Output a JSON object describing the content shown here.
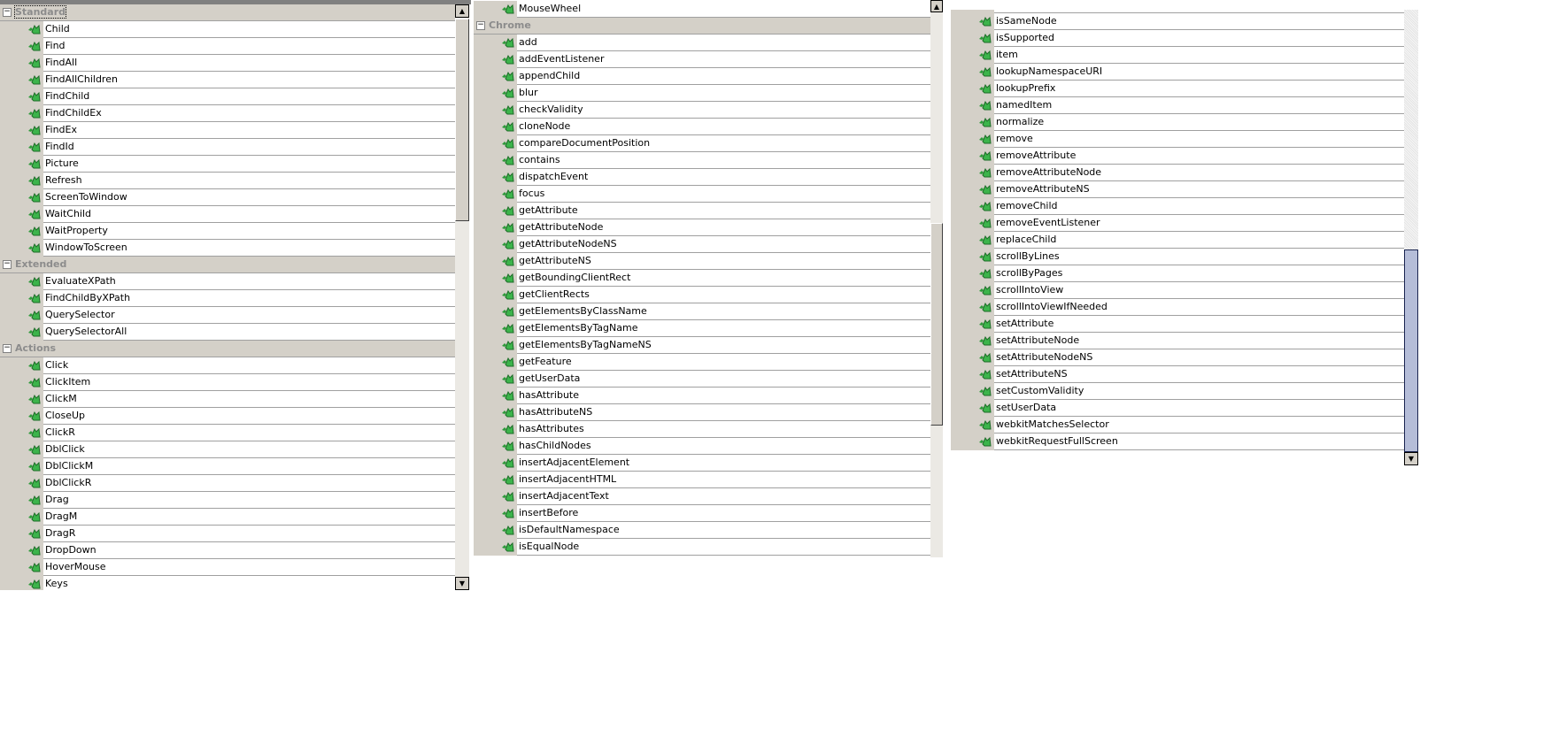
{
  "icons": {
    "method": "method-icon",
    "collapse": "collapse-toggle-icon"
  },
  "colors": {
    "header_bg": "#d4d0c8",
    "group_text": "#8c8c8c",
    "icon_green": "#2e9a3a",
    "thumb_blue": "#b5bdd8"
  },
  "panel1": {
    "rows": [
      {
        "type": "group",
        "label": "Standard"
      },
      {
        "type": "item",
        "label": "Child"
      },
      {
        "type": "item",
        "label": "Find"
      },
      {
        "type": "item",
        "label": "FindAll"
      },
      {
        "type": "item",
        "label": "FindAllChildren"
      },
      {
        "type": "item",
        "label": "FindChild"
      },
      {
        "type": "item",
        "label": "FindChildEx"
      },
      {
        "type": "item",
        "label": "FindEx"
      },
      {
        "type": "item",
        "label": "FindId"
      },
      {
        "type": "item",
        "label": "Picture"
      },
      {
        "type": "item",
        "label": "Refresh"
      },
      {
        "type": "item",
        "label": "ScreenToWindow"
      },
      {
        "type": "item",
        "label": "WaitChild"
      },
      {
        "type": "item",
        "label": "WaitProperty"
      },
      {
        "type": "item",
        "label": "WindowToScreen"
      },
      {
        "type": "group",
        "label": "Extended"
      },
      {
        "type": "item",
        "label": "EvaluateXPath"
      },
      {
        "type": "item",
        "label": "FindChildByXPath"
      },
      {
        "type": "item",
        "label": "QuerySelector"
      },
      {
        "type": "item",
        "label": "QuerySelectorAll"
      },
      {
        "type": "group",
        "label": "Actions"
      },
      {
        "type": "item",
        "label": "Click"
      },
      {
        "type": "item",
        "label": "ClickItem"
      },
      {
        "type": "item",
        "label": "ClickM"
      },
      {
        "type": "item",
        "label": "CloseUp"
      },
      {
        "type": "item",
        "label": "ClickR"
      },
      {
        "type": "item",
        "label": "DblClick"
      },
      {
        "type": "item",
        "label": "DblClickM"
      },
      {
        "type": "item",
        "label": "DblClickR"
      },
      {
        "type": "item",
        "label": "Drag"
      },
      {
        "type": "item",
        "label": "DragM"
      },
      {
        "type": "item",
        "label": "DragR"
      },
      {
        "type": "item",
        "label": "DropDown"
      },
      {
        "type": "item",
        "label": "HoverMouse"
      },
      {
        "type": "item",
        "label": "Keys"
      }
    ]
  },
  "panel2": {
    "rows": [
      {
        "type": "item",
        "label": "MouseWheel"
      },
      {
        "type": "group",
        "label": "Chrome"
      },
      {
        "type": "item",
        "label": "add"
      },
      {
        "type": "item",
        "label": "addEventListener"
      },
      {
        "type": "item",
        "label": "appendChild"
      },
      {
        "type": "item",
        "label": "blur"
      },
      {
        "type": "item",
        "label": "checkValidity"
      },
      {
        "type": "item",
        "label": "cloneNode"
      },
      {
        "type": "item",
        "label": "compareDocumentPosition"
      },
      {
        "type": "item",
        "label": "contains"
      },
      {
        "type": "item",
        "label": "dispatchEvent"
      },
      {
        "type": "item",
        "label": "focus"
      },
      {
        "type": "item",
        "label": "getAttribute"
      },
      {
        "type": "item",
        "label": "getAttributeNode"
      },
      {
        "type": "item",
        "label": "getAttributeNodeNS"
      },
      {
        "type": "item",
        "label": "getAttributeNS"
      },
      {
        "type": "item",
        "label": "getBoundingClientRect"
      },
      {
        "type": "item",
        "label": "getClientRects"
      },
      {
        "type": "item",
        "label": "getElementsByClassName"
      },
      {
        "type": "item",
        "label": "getElementsByTagName"
      },
      {
        "type": "item",
        "label": "getElementsByTagNameNS"
      },
      {
        "type": "item",
        "label": "getFeature"
      },
      {
        "type": "item",
        "label": "getUserData"
      },
      {
        "type": "item",
        "label": "hasAttribute"
      },
      {
        "type": "item",
        "label": "hasAttributeNS"
      },
      {
        "type": "item",
        "label": "hasAttributes"
      },
      {
        "type": "item",
        "label": "hasChildNodes"
      },
      {
        "type": "item",
        "label": "insertAdjacentElement"
      },
      {
        "type": "item",
        "label": "insertAdjacentHTML"
      },
      {
        "type": "item",
        "label": "insertAdjacentText"
      },
      {
        "type": "item",
        "label": "insertBefore"
      },
      {
        "type": "item",
        "label": "isDefaultNamespace"
      },
      {
        "type": "item",
        "label": "isEqualNode"
      }
    ]
  },
  "panel3": {
    "rows": [
      {
        "type": "item",
        "label": ""
      },
      {
        "type": "item",
        "label": "isSameNode"
      },
      {
        "type": "item",
        "label": "isSupported"
      },
      {
        "type": "item",
        "label": "item"
      },
      {
        "type": "item",
        "label": "lookupNamespaceURI"
      },
      {
        "type": "item",
        "label": "lookupPrefix"
      },
      {
        "type": "item",
        "label": "namedItem"
      },
      {
        "type": "item",
        "label": "normalize"
      },
      {
        "type": "item",
        "label": "remove"
      },
      {
        "type": "item",
        "label": "removeAttribute"
      },
      {
        "type": "item",
        "label": "removeAttributeNode"
      },
      {
        "type": "item",
        "label": "removeAttributeNS"
      },
      {
        "type": "item",
        "label": "removeChild"
      },
      {
        "type": "item",
        "label": "removeEventListener"
      },
      {
        "type": "item",
        "label": "replaceChild"
      },
      {
        "type": "item",
        "label": "scrollByLines"
      },
      {
        "type": "item",
        "label": "scrollByPages"
      },
      {
        "type": "item",
        "label": "scrollIntoView"
      },
      {
        "type": "item",
        "label": "scrollIntoViewIfNeeded"
      },
      {
        "type": "item",
        "label": "setAttribute"
      },
      {
        "type": "item",
        "label": "setAttributeNode"
      },
      {
        "type": "item",
        "label": "setAttributeNodeNS"
      },
      {
        "type": "item",
        "label": "setAttributeNS"
      },
      {
        "type": "item",
        "label": "setCustomValidity"
      },
      {
        "type": "item",
        "label": "setUserData"
      },
      {
        "type": "item",
        "label": "webkitMatchesSelector"
      },
      {
        "type": "item",
        "label": "webkitRequestFullScreen"
      }
    ]
  },
  "scroll": {
    "up_arrow": "▲",
    "down_arrow": "▼",
    "collapse_glyph": "−"
  }
}
